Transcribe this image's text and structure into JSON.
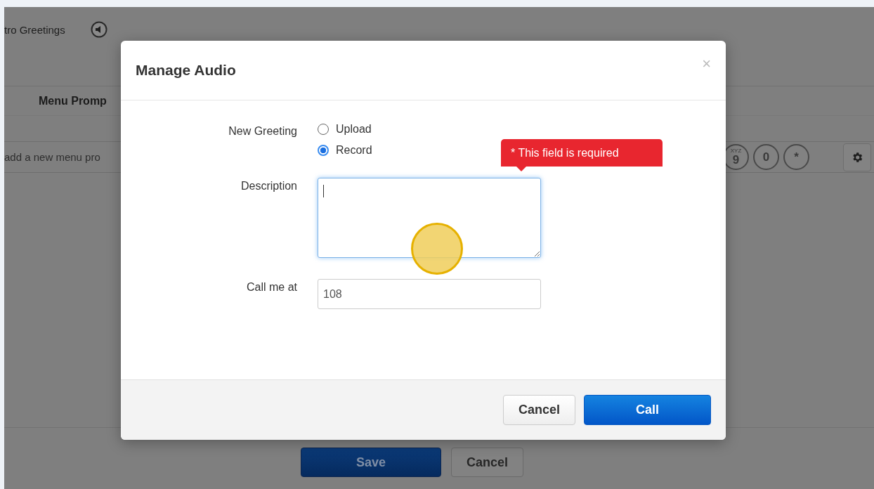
{
  "background_page": {
    "greeting_label": "tro Greetings",
    "table_header": "Menu Promp",
    "new_prompt_placeholder": "add a new menu pro",
    "keypad": [
      {
        "digit": "9",
        "letters": "XYZ"
      },
      {
        "digit": "0"
      },
      {
        "digit": "*"
      }
    ],
    "buttons": [
      {
        "label": "Save",
        "kind": "primary"
      },
      {
        "label": "Cancel",
        "kind": "default"
      }
    ]
  },
  "dialog": {
    "title": "Manage Audio",
    "close": "×",
    "fields": [
      {
        "kind": "radio",
        "label": "New Greeting",
        "options": [
          {
            "label": "Upload",
            "selected": false
          },
          {
            "label": "Record",
            "selected": true
          }
        ]
      },
      {
        "kind": "textarea",
        "label": "Description",
        "focused": true,
        "error": "* This field is required"
      },
      {
        "kind": "text",
        "label": "Call me at",
        "value": "108"
      }
    ],
    "buttons": [
      {
        "label": "Cancel",
        "kind": "default"
      },
      {
        "label": "Call",
        "kind": "primary"
      }
    ]
  }
}
